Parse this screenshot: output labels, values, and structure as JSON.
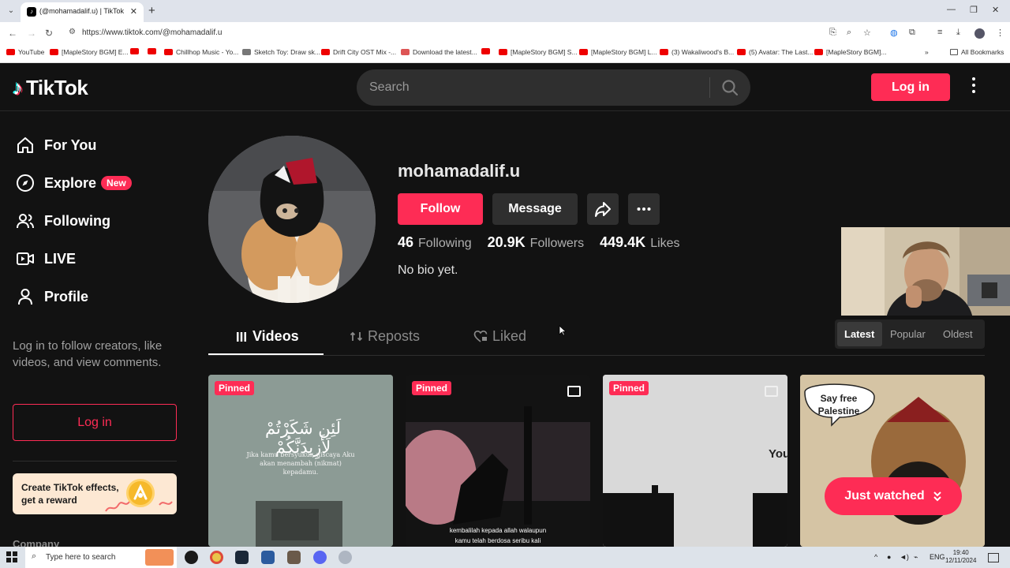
{
  "browser": {
    "tab_title": "(@mohamadalif.u) | TikTok",
    "url": "https://www.tiktok.com/@mohamadalif.u",
    "bookmarks": [
      "YouTube",
      "[MapleStory BGM] E...",
      "",
      "",
      "Chillhop Music - Yo...",
      "Sketch Toy: Draw sk...",
      "Drift City OST Mix -...",
      "Download the latest...",
      "",
      "[MapleStory BGM] S...",
      "[MapleStory BGM] L...",
      "(3) Wakaliwood's B...",
      "(5) Avatar: The Last...",
      "[MapleStory BGM]..."
    ],
    "all_bookmarks": "All Bookmarks"
  },
  "header": {
    "logo": "TikTok",
    "search_placeholder": "Search",
    "login": "Log in"
  },
  "sidebar": {
    "items": [
      {
        "label": "For You",
        "icon": "home-icon"
      },
      {
        "label": "Explore",
        "icon": "compass-icon",
        "badge": "New"
      },
      {
        "label": "Following",
        "icon": "users-icon"
      },
      {
        "label": "LIVE",
        "icon": "live-icon"
      },
      {
        "label": "Profile",
        "icon": "person-icon"
      }
    ],
    "login_prompt": "Log in to follow creators, like videos, and view comments.",
    "login_button": "Log in",
    "effects_banner": "Create TikTok effects, get a reward",
    "company": "Company"
  },
  "profile": {
    "username": "mohamadalif.u",
    "follow": "Follow",
    "message": "Message",
    "following_count": "46",
    "following_label": "Following",
    "followers_count": "20.9K",
    "followers_label": "Followers",
    "likes_count": "449.4K",
    "likes_label": "Likes",
    "bio": "No bio yet."
  },
  "tabs": {
    "videos": "Videos",
    "reposts": "Reposts",
    "liked": "Liked",
    "active": "Videos"
  },
  "sort": {
    "options": [
      "Latest",
      "Popular",
      "Oldest"
    ],
    "selected": "Latest"
  },
  "videos": [
    {
      "pinned": "Pinned",
      "arabic": "لَئِن شَكَرْتُمْ لَأَزِيدَنَّكُمْ",
      "caption": "Jika kamu bersyukur, niscaya Aku akan menambah (nikmat) kepadamu."
    },
    {
      "pinned": "Pinned",
      "caption_line1": "kembalilah kepada allah walaupun",
      "caption_line2": "kamu telah berdosa seribu kali"
    },
    {
      "pinned": "Pinned",
      "overlay": "You"
    },
    {
      "bubble": "Say free Palestine"
    }
  ],
  "just_watched": "Just watched",
  "taskbar": {
    "search": "Type here to search",
    "lang": "ENG",
    "time": "19:40",
    "date": "12/11/2024"
  },
  "colors": {
    "accent": "#fe2c55",
    "background": "#121212"
  }
}
